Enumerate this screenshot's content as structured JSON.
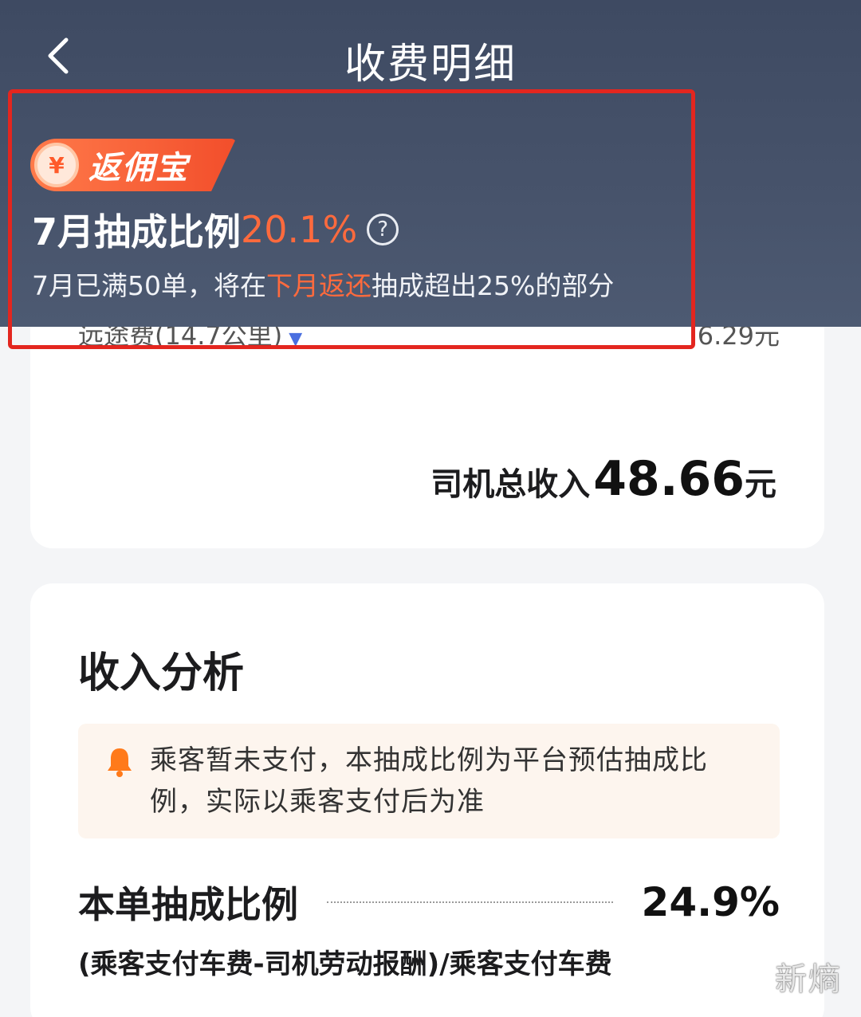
{
  "header": {
    "title": "收费明细"
  },
  "promo": {
    "badge_coin": "¥",
    "badge_label": "返佣宝",
    "rate_prefix": "7月抽成比例",
    "rate_value": "20.1%",
    "help": "?",
    "note_part1": "7月已满50单，将在",
    "note_highlight": "下月返还",
    "note_part2": "抽成超出25%的部分"
  },
  "fee_card": {
    "partial_label": "远途费(14.7公里)",
    "partial_value": "6.29元",
    "total_label": "司机总收入",
    "total_value": "48.66",
    "total_unit": "元"
  },
  "analysis": {
    "title": "收入分析",
    "notice": "乘客暂未支付，本抽成比例为平台预估抽成比例，实际以乘客支付后为准",
    "ratio_label": "本单抽成比例",
    "ratio_value": "24.9%",
    "formula": "(乘客支付车费-司机劳动报酬)/乘客支付车费"
  },
  "watermark": "新熵",
  "colors": {
    "header_bg": "#47536b",
    "accent_orange": "#ff6a3d",
    "highlight_frame": "#e3261f",
    "notice_bg": "#fdf5ee",
    "bell": "#ff7a1a"
  }
}
